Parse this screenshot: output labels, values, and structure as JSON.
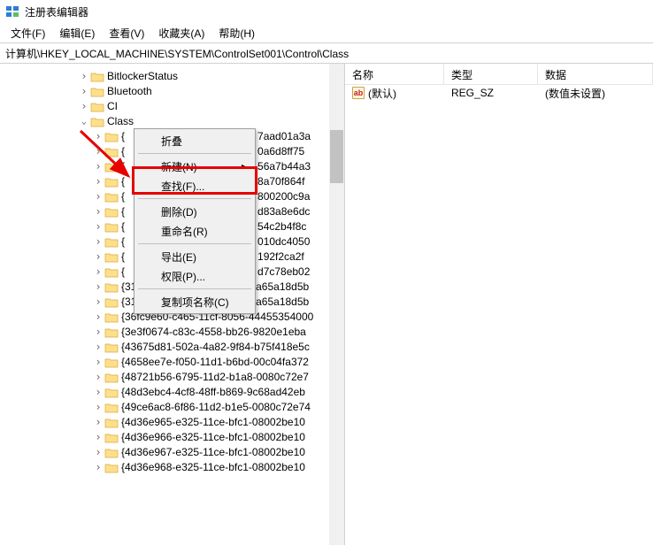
{
  "title": "注册表编辑器",
  "menubar": [
    "文件(F)",
    "编辑(E)",
    "查看(V)",
    "收藏夹(A)",
    "帮助(H)"
  ],
  "address": "计算机\\HKEY_LOCAL_MACHINE\\SYSTEM\\ControlSet001\\Control\\Class",
  "tree_top": [
    {
      "label": "BitlockerStatus",
      "depth": 5,
      "expanded": false
    },
    {
      "label": "Bluetooth",
      "depth": 5,
      "expanded": false
    },
    {
      "label": "CI",
      "depth": 5,
      "expanded": false
    },
    {
      "label": "Class",
      "depth": 5,
      "expanded": true
    }
  ],
  "tree_occluded": [
    {
      "suffix": "7aad01a3a"
    },
    {
      "suffix": "0a6d8ff75"
    },
    {
      "suffix": "56a7b44a3"
    },
    {
      "suffix": "8a70f864f"
    },
    {
      "suffix": "800200c9a"
    },
    {
      "suffix": "d83a8e6dc"
    },
    {
      "suffix": "54c2b4f8c"
    },
    {
      "suffix": "010dc4050"
    },
    {
      "suffix": "192f2ca2f"
    },
    {
      "suffix": "d7c78eb02"
    }
  ],
  "tree_full": [
    "{3163c566-d381-4467-87bc-a65a18d5b",
    "{3163c566-d381-4467-87bc-a65a18d5b",
    "{36fc9e60-c465-11cf-8056-44455354000",
    "{3e3f0674-c83c-4558-bb26-9820e1eba",
    "{43675d81-502a-4a82-9f84-b75f418e5c",
    "{4658ee7e-f050-11d1-b6bd-00c04fa372",
    "{48721b56-6795-11d2-b1a8-0080c72e7",
    "{48d3ebc4-4cf8-48ff-b869-9c68ad42eb",
    "{49ce6ac8-6f86-11d2-b1e5-0080c72e74",
    "{4d36e965-e325-11ce-bfc1-08002be10",
    "{4d36e966-e325-11ce-bfc1-08002be10",
    "{4d36e967-e325-11ce-bfc1-08002be10",
    "{4d36e968-e325-11ce-bfc1-08002be10"
  ],
  "context_menu": {
    "collapse": "折叠",
    "new": "新建(N)",
    "find": "查找(F)...",
    "delete": "删除(D)",
    "rename": "重命名(R)",
    "export": "导出(E)",
    "permissions": "权限(P)...",
    "copykey": "复制项名称(C)"
  },
  "list_columns": {
    "name": "名称",
    "type": "类型",
    "data": "数据"
  },
  "list_row": {
    "name": "(默认)",
    "type": "REG_SZ",
    "data": "(数值未设置)"
  }
}
